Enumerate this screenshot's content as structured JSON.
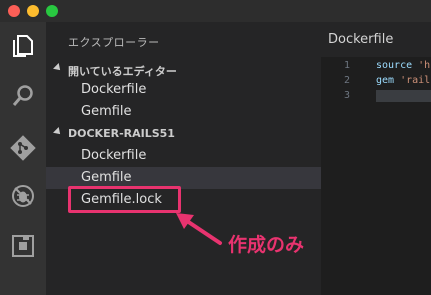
{
  "window": {
    "controls": [
      "close",
      "minimize",
      "zoom"
    ]
  },
  "activity_bar": {
    "icons": [
      "explorer-icon",
      "search-icon",
      "git-icon",
      "debug-icon",
      "extensions-icon"
    ]
  },
  "sidebar": {
    "title": "エクスプローラー",
    "open_editors": {
      "label": "開いているエディター",
      "files": [
        "Dockerfile",
        "Gemfile"
      ]
    },
    "project": {
      "label": "DOCKER-RAILS51",
      "files": [
        "Dockerfile",
        "Gemfile",
        "Gemfile.lock"
      ]
    }
  },
  "annotation": {
    "text": "作成のみ",
    "color": "#e8336f"
  },
  "editor": {
    "tab": "Dockerfile",
    "lines": [
      {
        "num": "1",
        "kw": "source ",
        "str": "'h"
      },
      {
        "num": "2",
        "kw": "gem ",
        "str": "'rail"
      },
      {
        "num": "3",
        "kw": "",
        "str": ""
      }
    ]
  }
}
